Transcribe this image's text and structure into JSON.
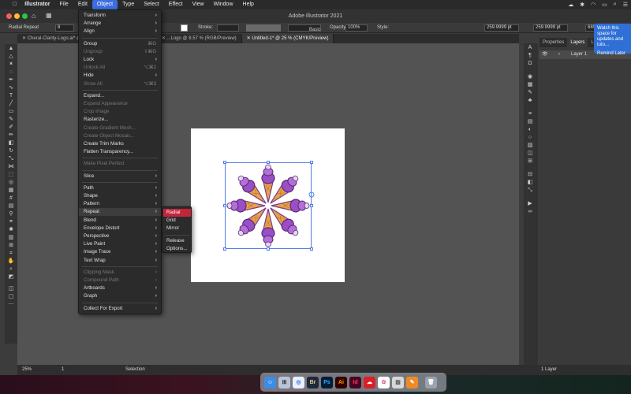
{
  "menubar": {
    "app_name": "Illustrator",
    "items": [
      "File",
      "Edit",
      "Object",
      "Type",
      "Select",
      "Effect",
      "View",
      "Window",
      "Help"
    ],
    "active_item": "Object"
  },
  "window": {
    "title": "Adobe Illustrator 2021"
  },
  "control_bar": {
    "selection_label": "Radial Repeat",
    "stroke_label": "Stroke:",
    "brush_label": "Basic",
    "opacity_label": "Opacity:",
    "opacity_value": "100%",
    "style_label": "Style:",
    "x_value": "259.9999 pt",
    "y_value": "259.9999 pt",
    "w_value": "680"
  },
  "tabs": [
    {
      "label": "Cheral-Clarity-Logo.ai* @ ...",
      "active": false
    },
    {
      "label": "...Logo @ 8.57 % (RGB/Preview)",
      "active": false
    },
    {
      "label": "Untitled-1* @ 25 % (CMYK/Preview)",
      "active": true
    }
  ],
  "object_menu": [
    {
      "label": "Transform",
      "arrow": true
    },
    {
      "label": "Arrange",
      "arrow": true
    },
    {
      "label": "Align",
      "arrow": true
    },
    {
      "sep": true
    },
    {
      "label": "Group",
      "shortcut": "⌘G"
    },
    {
      "label": "Ungroup",
      "shortcut": "⇧⌘G",
      "disabled": true
    },
    {
      "label": "Lock",
      "arrow": true
    },
    {
      "label": "Unlock All",
      "shortcut": "⌥⌘2",
      "disabled": true
    },
    {
      "label": "Hide",
      "arrow": true
    },
    {
      "label": "Show All",
      "shortcut": "⌥⌘3",
      "disabled": true
    },
    {
      "sep": true
    },
    {
      "label": "Expand..."
    },
    {
      "label": "Expand Appearance",
      "disabled": true
    },
    {
      "label": "Crop Image",
      "disabled": true
    },
    {
      "label": "Rasterize..."
    },
    {
      "label": "Create Gradient Mesh...",
      "disabled": true
    },
    {
      "label": "Create Object Mosaic...",
      "disabled": true
    },
    {
      "label": "Create Trim Marks"
    },
    {
      "label": "Flatten Transparency..."
    },
    {
      "sep": true
    },
    {
      "label": "Make Pixel Perfect",
      "disabled": true
    },
    {
      "sep": true
    },
    {
      "label": "Slice",
      "arrow": true
    },
    {
      "sep": true
    },
    {
      "label": "Path",
      "arrow": true
    },
    {
      "label": "Shape",
      "arrow": true
    },
    {
      "label": "Pattern",
      "arrow": true
    },
    {
      "label": "Repeat",
      "arrow": true,
      "highlighted": true
    },
    {
      "label": "Blend",
      "arrow": true
    },
    {
      "label": "Envelope Distort",
      "arrow": true
    },
    {
      "label": "Perspective",
      "arrow": true
    },
    {
      "label": "Live Paint",
      "arrow": true
    },
    {
      "label": "Image Trace",
      "arrow": true
    },
    {
      "label": "Text Wrap",
      "arrow": true
    },
    {
      "sep": true
    },
    {
      "label": "Clipping Mask",
      "arrow": true,
      "disabled": true
    },
    {
      "label": "Compound Path",
      "arrow": true,
      "disabled": true
    },
    {
      "label": "Artboards",
      "arrow": true
    },
    {
      "label": "Graph",
      "arrow": true
    },
    {
      "sep": true
    },
    {
      "label": "Collect For Export",
      "arrow": true
    }
  ],
  "repeat_submenu": [
    {
      "label": "Radial",
      "selected": true
    },
    {
      "label": "Grid"
    },
    {
      "label": "Mirror"
    },
    {
      "sep": true
    },
    {
      "label": "Release"
    },
    {
      "label": "Options..."
    }
  ],
  "panel": {
    "tabs": [
      "Properties",
      "Layers",
      "Libr..."
    ],
    "active_tab": "Layers",
    "layer_name": "Layer 1",
    "footer": "1 Layer"
  },
  "notification": {
    "text": "Watch this space for updates and tuto...",
    "action": "Remind Later"
  },
  "status": {
    "zoom": "25%",
    "artboard": "1",
    "tool": "Selection"
  },
  "dock_apps": [
    "Finder",
    "Launchpad",
    "Safari",
    "Bridge",
    "Photoshop",
    "Illustrator",
    "InDesign",
    "Creative Cloud",
    "Photos",
    "Preview",
    "Pages",
    "Trash"
  ],
  "colors": {
    "menu_bg": "#2b2b2b",
    "selection_red": "#c4233a",
    "selection_blue": "#4f7de6",
    "canvas": "#535353"
  }
}
